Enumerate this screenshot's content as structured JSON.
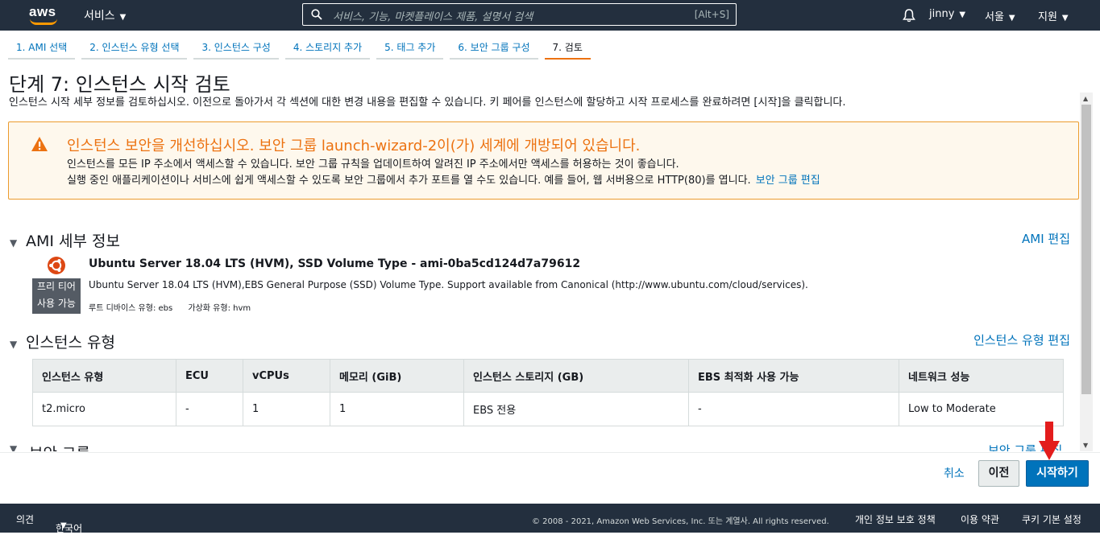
{
  "topnav": {
    "logo_text": "aws",
    "services_label": "서비스",
    "search_placeholder": "서비스, 기능, 마켓플레이스 제품, 설명서 검색",
    "search_shortcut": "[Alt+S]",
    "user": "jinny",
    "region": "서울",
    "support": "지원"
  },
  "steps": [
    {
      "label": "1. AMI 선택"
    },
    {
      "label": "2. 인스턴스 유형 선택"
    },
    {
      "label": "3. 인스턴스 구성"
    },
    {
      "label": "4. 스토리지 추가"
    },
    {
      "label": "5. 태그 추가"
    },
    {
      "label": "6. 보안 그룹 구성"
    },
    {
      "label": "7. 검토"
    }
  ],
  "page": {
    "title": "단계 7: 인스턴스 시작 검토",
    "description": "인스턴스 시작 세부 정보를 검토하십시오. 이전으로 돌아가서 각 섹션에 대한 변경 내용을 편집할 수 있습니다. 키 페어를 인스턴스에 할당하고 시작 프로세스를 완료하려면 [시작]을 클릭합니다."
  },
  "alert": {
    "title": "인스턴스 보안을 개선하십시오. 보안 그룹 launch-wizard-2이(가) 세계에 개방되어 있습니다.",
    "line1": "인스턴스를 모든 IP 주소에서 액세스할 수 있습니다. 보안 그룹 규칙을 업데이트하여 알려진 IP 주소에서만 액세스를 허용하는 것이 좋습니다.",
    "line2": "실행 중인 애플리케이션이나 서비스에 쉽게 액세스할 수 있도록 보안 그룹에서 추가 포트를 열 수도 있습니다. 예를 들어, 웹 서버용으로 HTTP(80)를 엽니다.",
    "link": "보안 그룹 편집"
  },
  "ami": {
    "section_title": "AMI 세부 정보",
    "edit_link": "AMI 편집",
    "name": "Ubuntu Server 18.04 LTS (HVM), SSD Volume Type - ami-0ba5cd124d7a79612",
    "description": "Ubuntu Server 18.04 LTS (HVM),EBS General Purpose (SSD) Volume Type. Support available from Canonical (http://www.ubuntu.com/cloud/services).",
    "free_tier_line1": "프리 티어",
    "free_tier_line2": "사용 가능",
    "root_device": "루트 디바이스 유형: ebs",
    "virtualization": "가상화 유형: hvm"
  },
  "instance_type": {
    "section_title": "인스턴스 유형",
    "edit_link": "인스턴스 유형 편집",
    "headers": [
      "인스턴스 유형",
      "ECU",
      "vCPUs",
      "메모리 (GiB)",
      "인스턴스 스토리지 (GB)",
      "EBS 최적화 사용 가능",
      "네트워크 성능"
    ],
    "row": [
      "t2.micro",
      "-",
      "1",
      "1",
      "EBS 전용",
      "-",
      "Low to Moderate"
    ]
  },
  "security_group": {
    "section_title": "보안 그룹",
    "edit_link": "보안 그룹 편집"
  },
  "actions": {
    "cancel": "취소",
    "previous": "이전",
    "launch": "시작하기"
  },
  "footer": {
    "feedback": "의견",
    "language": "한국어",
    "copyright": "© 2008 - 2021, Amazon Web Services, Inc. 또는 계열사. All rights reserved.",
    "privacy": "개인 정보 보호 정책",
    "terms": "이용 약관",
    "cookies": "쿠키 기본 설정"
  },
  "colors": {
    "nav_bg": "#232f3e",
    "accent_orange": "#ec7211",
    "link_blue": "#0073bb",
    "arrow_red": "#e31c1c"
  }
}
